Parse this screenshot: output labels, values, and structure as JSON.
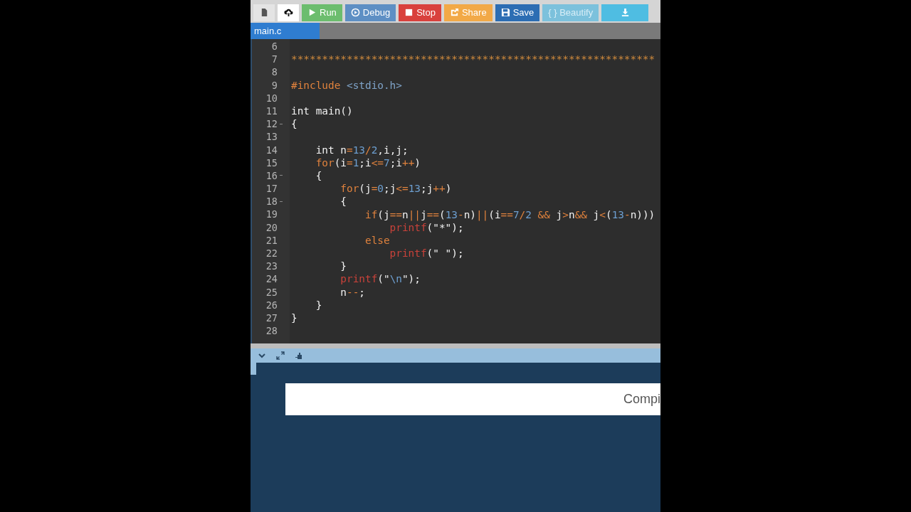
{
  "toolbar": [
    {
      "kind": "file",
      "color": "#e4e4e4"
    },
    {
      "kind": "upload",
      "color": "#ffffff"
    },
    {
      "kind": "play",
      "label": "Run",
      "color": "#6cbd6e"
    },
    {
      "kind": "debug",
      "label": "Debug",
      "color": "#5e8fc4"
    },
    {
      "kind": "stop",
      "label": "Stop",
      "color": "#d9413d"
    },
    {
      "kind": "share",
      "label": "Share",
      "color": "#f2a947"
    },
    {
      "kind": "save",
      "label": "Save",
      "color": "#2c6db3"
    },
    {
      "kind": "text",
      "label": "{ } Beautify",
      "color": "#7cc1dc"
    },
    {
      "kind": "download",
      "color": "#4fbde2"
    }
  ],
  "tabs": [
    {
      "label": "main.c",
      "selected": true
    }
  ],
  "editor": {
    "lines": [
      {
        "n": "6",
        "fold": false
      },
      {
        "n": "7",
        "fold": false,
        "tokens": [
          {
            "kind": "comment",
            "t": "***********************************************************"
          }
        ]
      },
      {
        "n": "8",
        "fold": false
      },
      {
        "n": "9",
        "fold": false,
        "tokens": [
          {
            "kind": "pre",
            "t": "#include"
          },
          {
            "kind": "header",
            "t": " <stdio.h>"
          }
        ]
      },
      {
        "n": "10",
        "fold": false
      },
      {
        "n": "11",
        "fold": false,
        "tokens": [
          {
            "kind": "plain",
            "t": "int main()"
          }
        ]
      },
      {
        "n": "12",
        "fold": true,
        "tokens": [
          {
            "kind": "plain",
            "t": "{"
          }
        ]
      },
      {
        "n": "13",
        "fold": false
      },
      {
        "n": "14",
        "fold": false,
        "tokens": [
          {
            "kind": "plain",
            "t": "    int n"
          },
          {
            "kind": "op",
            "t": "="
          },
          {
            "kind": "num",
            "t": "13"
          },
          {
            "kind": "op",
            "t": "/"
          },
          {
            "kind": "num",
            "t": "2"
          },
          {
            "kind": "plain",
            "t": ",i,j;"
          }
        ]
      },
      {
        "n": "15",
        "fold": false,
        "tokens": [
          {
            "kind": "keyword",
            "t": "    for"
          },
          {
            "kind": "plain",
            "t": "(i"
          },
          {
            "kind": "op",
            "t": "="
          },
          {
            "kind": "num",
            "t": "1"
          },
          {
            "kind": "plain",
            "t": ";i"
          },
          {
            "kind": "op",
            "t": "<="
          },
          {
            "kind": "num",
            "t": "7"
          },
          {
            "kind": "plain",
            "t": ";i"
          },
          {
            "kind": "op",
            "t": "++"
          },
          {
            "kind": "plain",
            "t": ")"
          }
        ]
      },
      {
        "n": "16",
        "fold": true,
        "tokens": [
          {
            "kind": "plain",
            "t": "    {"
          }
        ]
      },
      {
        "n": "17",
        "fold": false,
        "tokens": [
          {
            "kind": "keyword",
            "t": "        for"
          },
          {
            "kind": "plain",
            "t": "(j"
          },
          {
            "kind": "op",
            "t": "="
          },
          {
            "kind": "num",
            "t": "0"
          },
          {
            "kind": "plain",
            "t": ";j"
          },
          {
            "kind": "op",
            "t": "<="
          },
          {
            "kind": "num",
            "t": "13"
          },
          {
            "kind": "plain",
            "t": ";j"
          },
          {
            "kind": "op",
            "t": "++"
          },
          {
            "kind": "plain",
            "t": ")"
          }
        ]
      },
      {
        "n": "18",
        "fold": true,
        "tokens": [
          {
            "kind": "plain",
            "t": "        {"
          }
        ]
      },
      {
        "n": "19",
        "fold": false,
        "tokens": [
          {
            "kind": "keyword",
            "t": "            if"
          },
          {
            "kind": "plain",
            "t": "(j"
          },
          {
            "kind": "op",
            "t": "=="
          },
          {
            "kind": "plain",
            "t": "n"
          },
          {
            "kind": "op",
            "t": "||"
          },
          {
            "kind": "plain",
            "t": "j"
          },
          {
            "kind": "op",
            "t": "=="
          },
          {
            "kind": "plain",
            "t": "("
          },
          {
            "kind": "num",
            "t": "13"
          },
          {
            "kind": "op",
            "t": "-"
          },
          {
            "kind": "plain",
            "t": "n)"
          },
          {
            "kind": "op",
            "t": "||"
          },
          {
            "kind": "plain",
            "t": "(i"
          },
          {
            "kind": "op",
            "t": "=="
          },
          {
            "kind": "num",
            "t": "7"
          },
          {
            "kind": "op",
            "t": "/"
          },
          {
            "kind": "num",
            "t": "2"
          },
          {
            "kind": "op",
            "t": " &&"
          },
          {
            "kind": "plain",
            "t": " j"
          },
          {
            "kind": "op",
            "t": ">"
          },
          {
            "kind": "plain",
            "t": "n"
          },
          {
            "kind": "op",
            "t": "&&"
          },
          {
            "kind": "plain",
            "t": " j"
          },
          {
            "kind": "op",
            "t": "<"
          },
          {
            "kind": "plain",
            "t": "("
          },
          {
            "kind": "num",
            "t": "13"
          },
          {
            "kind": "op",
            "t": "-"
          },
          {
            "kind": "plain",
            "t": "n)))"
          }
        ]
      },
      {
        "n": "20",
        "fold": false,
        "tokens": [
          {
            "kind": "func",
            "t": "                printf"
          },
          {
            "kind": "plain",
            "t": "(\"*\");"
          }
        ]
      },
      {
        "n": "21",
        "fold": false,
        "tokens": [
          {
            "kind": "keyword",
            "t": "            else"
          }
        ]
      },
      {
        "n": "22",
        "fold": false,
        "tokens": [
          {
            "kind": "func",
            "t": "                printf"
          },
          {
            "kind": "plain",
            "t": "(\" \");"
          }
        ]
      },
      {
        "n": "23",
        "fold": false,
        "tokens": [
          {
            "kind": "plain",
            "t": "        }"
          }
        ]
      },
      {
        "n": "24",
        "fold": false,
        "tokens": [
          {
            "kind": "func",
            "t": "        printf"
          },
          {
            "kind": "plain",
            "t": "(\""
          },
          {
            "kind": "num",
            "t": "\\n"
          },
          {
            "kind": "plain",
            "t": "\");"
          }
        ]
      },
      {
        "n": "25",
        "fold": false,
        "tokens": [
          {
            "kind": "plain",
            "t": "        n"
          },
          {
            "kind": "op",
            "t": "--"
          },
          {
            "kind": "plain",
            "t": ";"
          }
        ]
      },
      {
        "n": "26",
        "fold": false,
        "tokens": [
          {
            "kind": "plain",
            "t": "    }"
          }
        ]
      },
      {
        "n": "27",
        "fold": false,
        "tokens": [
          {
            "kind": "plain",
            "t": "}"
          }
        ]
      },
      {
        "n": "28",
        "fold": false
      }
    ]
  },
  "output": {
    "status": "Compi"
  }
}
